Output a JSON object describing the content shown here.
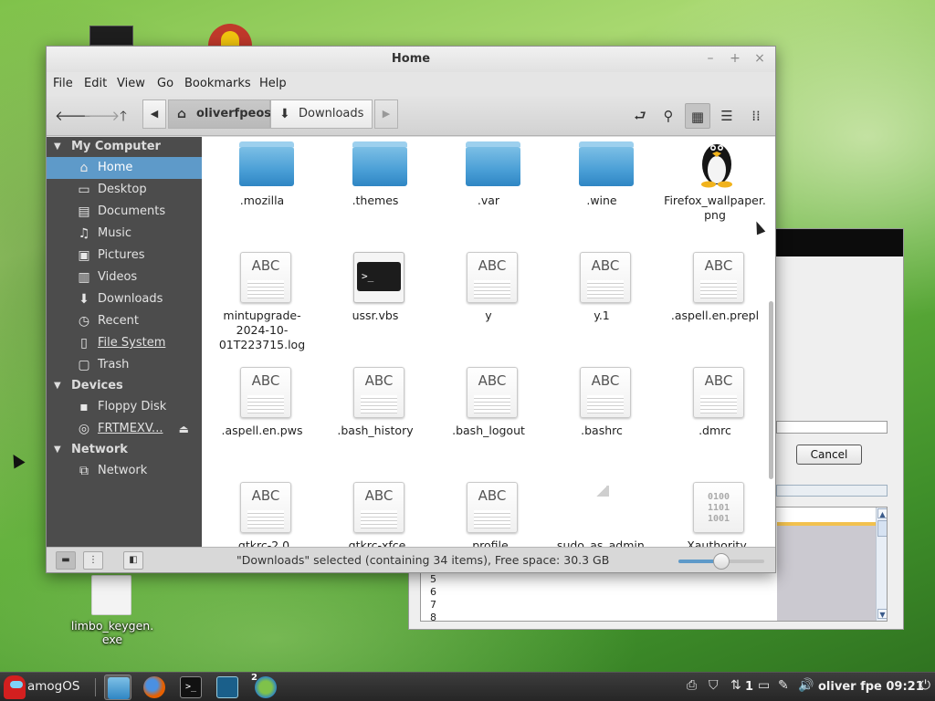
{
  "window": {
    "title": "Home",
    "controls": {
      "minimize": "–",
      "maximize": "+",
      "close": "×"
    }
  },
  "menubar": [
    "File",
    "Edit",
    "View",
    "Go",
    "Bookmarks",
    "Help"
  ],
  "toolbar": {
    "breadcrumbs": [
      {
        "label": "oliverfpeos",
        "icon": "home-icon",
        "active": true
      },
      {
        "label": "Downloads",
        "icon": "download-icon",
        "active": false
      }
    ],
    "active_view": "icon-view"
  },
  "sidebar": {
    "sections": [
      {
        "title": "My Computer",
        "items": [
          {
            "label": "Home",
            "icon": "home-icon",
            "selected": true
          },
          {
            "label": "Desktop",
            "icon": "desktop-icon"
          },
          {
            "label": "Documents",
            "icon": "documents-icon"
          },
          {
            "label": "Music",
            "icon": "music-icon"
          },
          {
            "label": "Pictures",
            "icon": "pictures-icon"
          },
          {
            "label": "Videos",
            "icon": "videos-icon"
          },
          {
            "label": "Downloads",
            "icon": "download-icon"
          },
          {
            "label": "Recent",
            "icon": "recent-icon"
          },
          {
            "label": "File System",
            "icon": "drive-icon"
          },
          {
            "label": "Trash",
            "icon": "trash-icon"
          }
        ]
      },
      {
        "title": "Devices",
        "items": [
          {
            "label": "Floppy Disk",
            "icon": "floppy-icon"
          },
          {
            "label": "FRTMEXV...",
            "icon": "disc-icon",
            "eject": true
          }
        ]
      },
      {
        "title": "Network",
        "items": [
          {
            "label": "Network",
            "icon": "network-icon"
          }
        ]
      }
    ]
  },
  "files": [
    {
      "name": ".mozilla",
      "type": "folder"
    },
    {
      "name": ".themes",
      "type": "folder"
    },
    {
      "name": ".var",
      "type": "folder"
    },
    {
      "name": ".wine",
      "type": "folder"
    },
    {
      "name": "Firefox_wallpaper.\npng",
      "type": "image"
    },
    {
      "name": "mintupgrade-\n2024-10-\n01T223715.log",
      "type": "text"
    },
    {
      "name": "ussr.vbs",
      "type": "script"
    },
    {
      "name": "y",
      "type": "text"
    },
    {
      "name": "y.1",
      "type": "text"
    },
    {
      "name": ".aspell.en.prepl",
      "type": "text"
    },
    {
      "name": ".aspell.en.pws",
      "type": "text"
    },
    {
      "name": ".bash_history",
      "type": "text"
    },
    {
      "name": ".bash_logout",
      "type": "text"
    },
    {
      "name": ".bashrc",
      "type": "text"
    },
    {
      "name": ".dmrc",
      "type": "text"
    },
    {
      "name": ".gtkrc-2.0",
      "type": "text"
    },
    {
      "name": ".gtkrc-xfce",
      "type": "text"
    },
    {
      "name": ".profile",
      "type": "text"
    },
    {
      "name": ".sudo_as_admin_",
      "type": "empty"
    },
    {
      "name": ".Xauthority",
      "type": "binary"
    }
  ],
  "icon_text": {
    "doc": "ABC",
    "terminal": ">_",
    "binary": "0100\n1101\n1001"
  },
  "statusbar": {
    "text": "\"Downloads\" selected (containing 34 items), Free space: 30.3 GB",
    "zoom_fraction": 0.5
  },
  "desktop": {
    "file_label": "limbo_keygen.\nexe"
  },
  "bg_dialog": {
    "cancel_label": "Cancel",
    "line_numbers": [
      "5",
      "6",
      "7",
      "8"
    ]
  },
  "taskbar": {
    "menu_label": "amogOS",
    "badge": "2",
    "tray_count": "1",
    "user_time": "oliver fpe 09:21"
  },
  "colors": {
    "selection": "#5e9ac9",
    "sidebar_bg": "#4c4c4c",
    "folder": "#4a9fd6"
  }
}
